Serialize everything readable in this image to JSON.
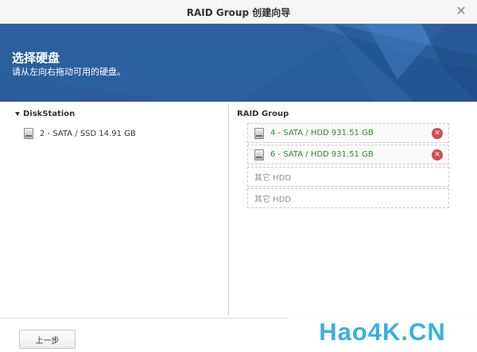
{
  "window": {
    "title": "RAID Group 创建向导",
    "close_symbol": "✕"
  },
  "banner": {
    "title": "选择硬盘",
    "subtitle": "请从左向右拖动可用的硬盘。"
  },
  "left": {
    "header": "DiskStation",
    "disks": [
      {
        "label": "2 - SATA / SSD 14.91 GB",
        "icon": "disk-icon"
      }
    ]
  },
  "right": {
    "header": "RAID Group",
    "slots": [
      {
        "label": "4 - SATA / HDD 931.51 GB",
        "filled": true,
        "remove_symbol": "✕"
      },
      {
        "label": "6 - SATA / HDD 931.51 GB",
        "filled": true,
        "remove_symbol": "✕"
      },
      {
        "label": "其它 HDD",
        "filled": false
      },
      {
        "label": "其它 HDD",
        "filled": false
      }
    ]
  },
  "footer": {
    "back_label": "上一步"
  },
  "watermark": {
    "text": "Hao4K.CN"
  },
  "colors": {
    "banner_blue": "#2c5f9e",
    "disk_label_green": "#2f8a2f",
    "remove_red": "#d84c4c",
    "watermark_blue": "#39b0e3"
  }
}
